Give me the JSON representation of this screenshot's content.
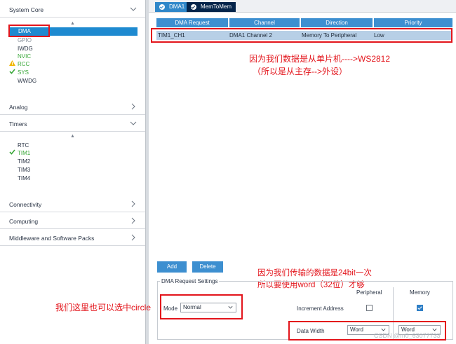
{
  "sidebar": {
    "system_core": {
      "title": "System Core",
      "sort_glyph": "▲",
      "items": [
        {
          "label": "DMA",
          "status": "selected"
        },
        {
          "label": "GPIO",
          "status": "disabled"
        },
        {
          "label": "IWDG",
          "status": "normal"
        },
        {
          "label": "NVIC",
          "status": "ok"
        },
        {
          "label": "RCC",
          "status": "warning"
        },
        {
          "label": "SYS",
          "status": "checked"
        },
        {
          "label": "WWDG",
          "status": "normal"
        }
      ]
    },
    "analog": {
      "title": "Analog"
    },
    "timers": {
      "title": "Timers",
      "sort_glyph": "▲",
      "items": [
        {
          "label": "RTC",
          "status": "normal"
        },
        {
          "label": "TIM1",
          "status": "checked"
        },
        {
          "label": "TIM2",
          "status": "normal"
        },
        {
          "label": "TIM3",
          "status": "normal"
        },
        {
          "label": "TIM4",
          "status": "normal"
        }
      ]
    },
    "connectivity": {
      "title": "Connectivity"
    },
    "computing": {
      "title": "Computing"
    },
    "middleware": {
      "title": "Middleware and Software Packs"
    }
  },
  "tabs": [
    {
      "label": "DMA1",
      "active": true
    },
    {
      "label": "MemToMem",
      "active": false
    }
  ],
  "table": {
    "headers": [
      "DMA Request",
      "Channel",
      "Direction",
      "Priority"
    ],
    "rows": [
      [
        "TIM1_CH1",
        "DMA1 Channel 2",
        "Memory To Peripheral",
        "Low"
      ]
    ]
  },
  "annotations": {
    "note1_line1": "因为我们数据是从单片机---->WS2812",
    "note1_line2": "（所以是从主存-->外设）",
    "note2_line1": "因为我们传输的数据是24bit一次",
    "note2_line2": "所以要使用word（32位）才够",
    "note3": "我们这里也可以选中circle"
  },
  "buttons": {
    "add": "Add",
    "delete": "Delete"
  },
  "settings": {
    "title": "DMA Request Settings",
    "col_peripheral": "Peripheral",
    "col_memory": "Memory",
    "mode_label": "Mode",
    "mode_value": "Normal",
    "increment_label": "Increment Address",
    "increment_peripheral": false,
    "increment_memory": true,
    "data_width_label": "Data Width",
    "data_width_peripheral": "Word",
    "data_width_memory": "Word"
  },
  "watermark": "CSDN @m0_63077733",
  "colors": {
    "accent": "#3d8fd0",
    "selected_row": "#b7cfe6",
    "annotation_red": "#e3141b",
    "ok_green": "#3aa83a",
    "warning_yellow": "#f2b705",
    "tab_dark": "#04244a"
  }
}
